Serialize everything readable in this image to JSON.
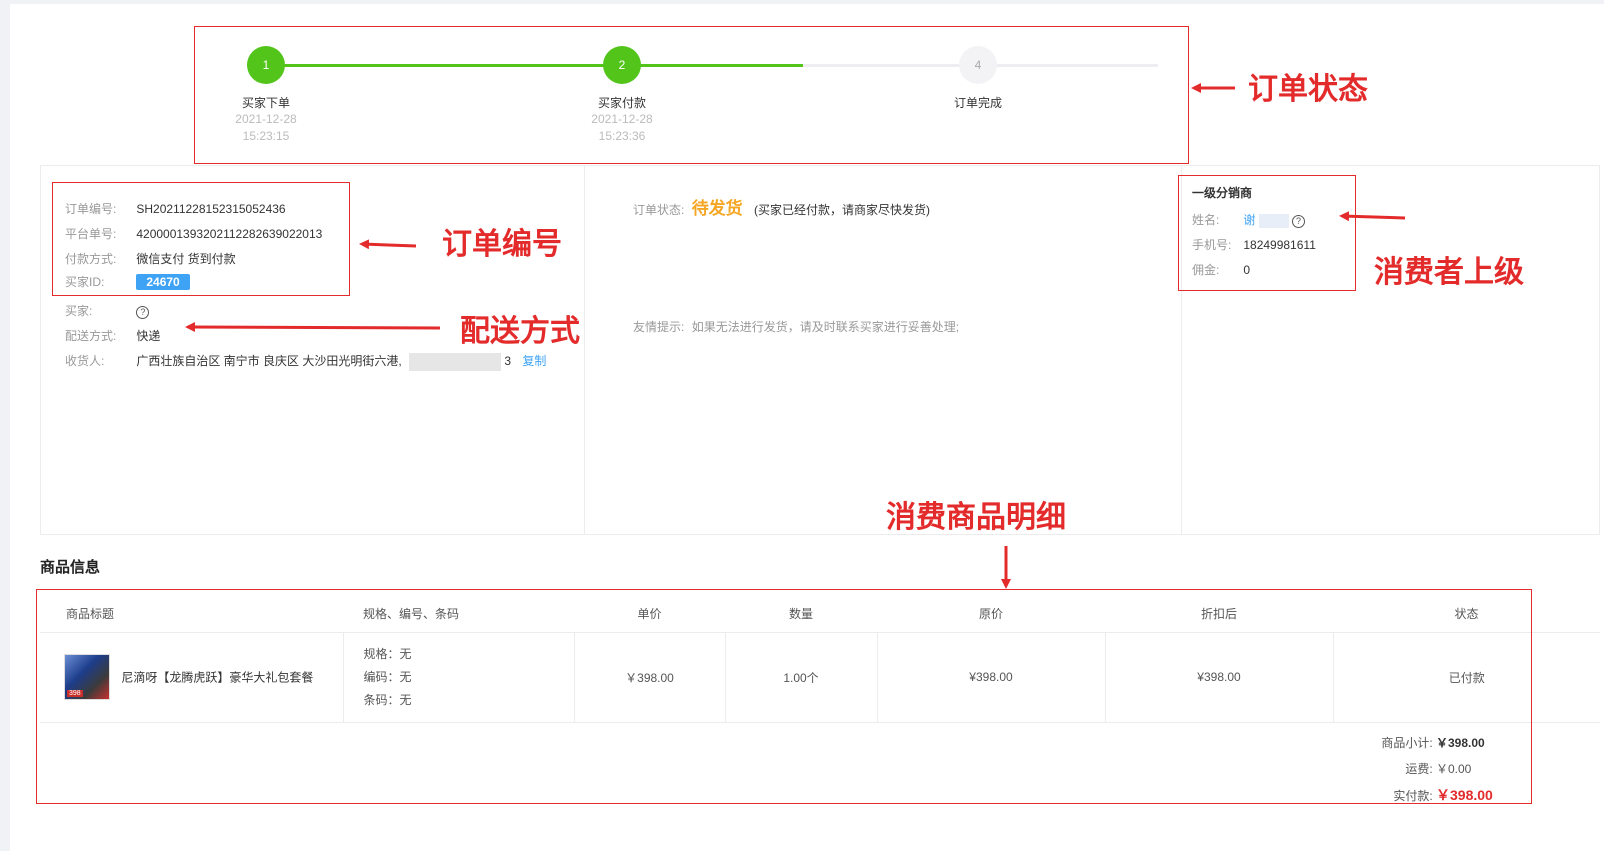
{
  "steps": [
    {
      "num": "1",
      "label": "买家下单",
      "date": "2021-12-28",
      "time": "15:23:15",
      "done": true
    },
    {
      "num": "2",
      "label": "买家付款",
      "date": "2021-12-28",
      "time": "15:23:36",
      "done": true
    },
    {
      "num": "4",
      "label": "订单完成",
      "date": "",
      "time": "",
      "done": false
    }
  ],
  "order": {
    "order_no_label": "订单编号:",
    "order_no": "SH20211228152315052436",
    "platform_no_label": "平台单号:",
    "platform_no": "4200001393202112282639022013",
    "pay_label": "付款方式:",
    "pay": "微信支付 货到付款",
    "buyer_id_label": "买家ID:",
    "buyer_id": "24670",
    "buyer_label": "买家:",
    "delivery_label": "配送方式:",
    "delivery": "快递",
    "receiver_label": "收货人:",
    "receiver": "广西壮族自治区 南宁市 良庆区 大沙田光明街六港,",
    "receiver_tail": "3",
    "copy": "复制"
  },
  "status": {
    "label": "订单状态:",
    "value": "待发货",
    "note": "(买家已经付款，请商家尽快发货)",
    "tip_label": "友情提示:",
    "tip": "如果无法进行发货，请及时联系买家进行妥善处理;"
  },
  "distributor": {
    "title": "一级分销商",
    "name_label": "姓名:",
    "name": "谢",
    "phone_label": "手机号:",
    "phone": "18249981611",
    "commission_label": "佣金:",
    "commission": "0"
  },
  "annotations": {
    "order_status": "订单状态",
    "order_no": "订单编号",
    "delivery": "配送方式",
    "superior": "消费者上级",
    "goods": "消费商品明细"
  },
  "goods": {
    "section_title": "商品信息",
    "headers": [
      "商品标题",
      "规格、编号、条码",
      "单价",
      "数量",
      "原价",
      "折扣后",
      "状态"
    ],
    "item": {
      "title": "尼滴呀【龙腾虎跃】豪华大礼包套餐",
      "spec": "规格：无",
      "code": "编码：无",
      "barcode": "条码：无",
      "price": "￥398.00",
      "qty": "1.00个",
      "orig": "¥398.00",
      "discounted": "¥398.00",
      "state": "已付款",
      "thumb_text": "398"
    },
    "subtotal_label": "商品小计:",
    "subtotal": "￥398.00",
    "freight_label": "运费:",
    "freight": "￥0.00",
    "paid_label": "实付款:",
    "paid": "￥398.00"
  },
  "colors": {
    "green": "#52c41a",
    "red": "#e32b2b",
    "orange": "#f5a623",
    "blue": "#3ea3f5"
  }
}
